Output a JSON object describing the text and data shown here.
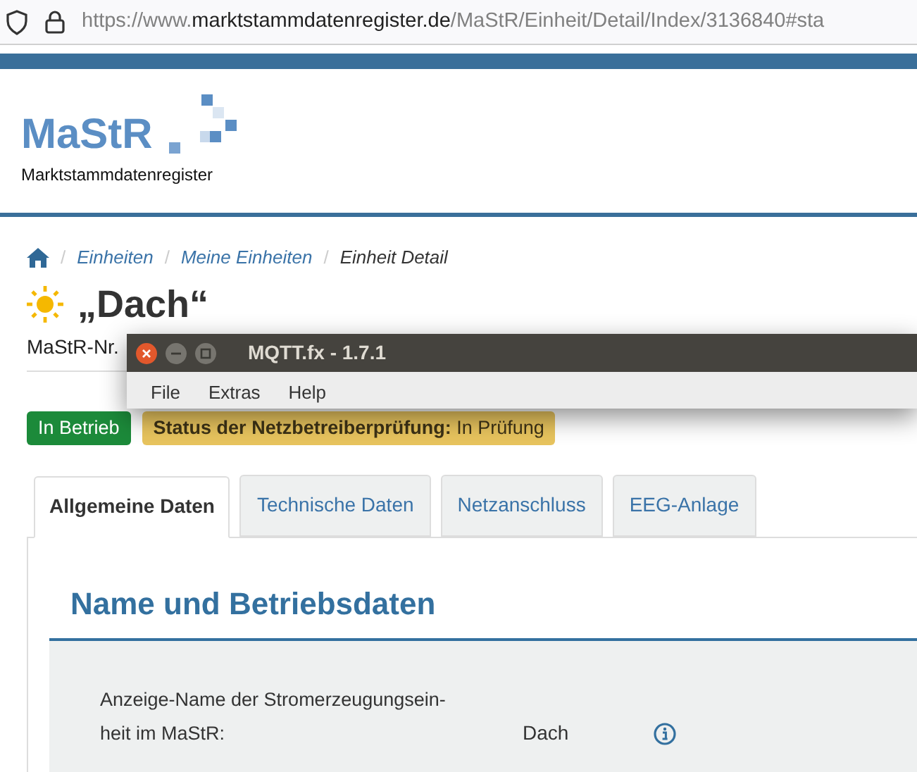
{
  "browser": {
    "url": {
      "scheme": "https://www.",
      "domain": "marktstammdatenregister.de",
      "path": "/MaStR/Einheit/Detail/Index/3136840#sta"
    }
  },
  "logo": {
    "wordmark": "MaStR",
    "subtitle": "Marktstammdatenregister"
  },
  "breadcrumbs": [
    {
      "separator": "/",
      "label": "Einheiten",
      "link": true
    },
    {
      "separator": "/",
      "label": "Meine Einheiten",
      "link": true
    },
    {
      "separator": "/",
      "label": "Einheit Detail",
      "link": false
    }
  ],
  "unit": {
    "title": "„Dach“",
    "number_label": "MaStR-Nr."
  },
  "badges": [
    {
      "kind": "operation",
      "text": "In Betrieb"
    },
    {
      "kind": "review",
      "text": "**Status der Netzbetreiberprüfung:** In Prüfung"
    }
  ],
  "tabs": [
    {
      "label": "Allgemeine Daten",
      "selected": true
    },
    {
      "label": "Technische Daten",
      "selected": false
    },
    {
      "label": "Netzanschluss",
      "selected": false
    },
    {
      "label": "EEG-Anlage",
      "selected": false
    }
  ],
  "section": {
    "heading": "Name und Betriebsdaten",
    "rows": [
      {
        "label_lines": [
          "Anzeige-Name der Stromerzeugungsein-",
          "heit im MaStR:"
        ],
        "value": "Dach"
      }
    ]
  },
  "overlay_window": {
    "title": "MQTT.fx - 1.7.1",
    "menu": [
      "File",
      "Extras",
      "Help"
    ]
  }
}
